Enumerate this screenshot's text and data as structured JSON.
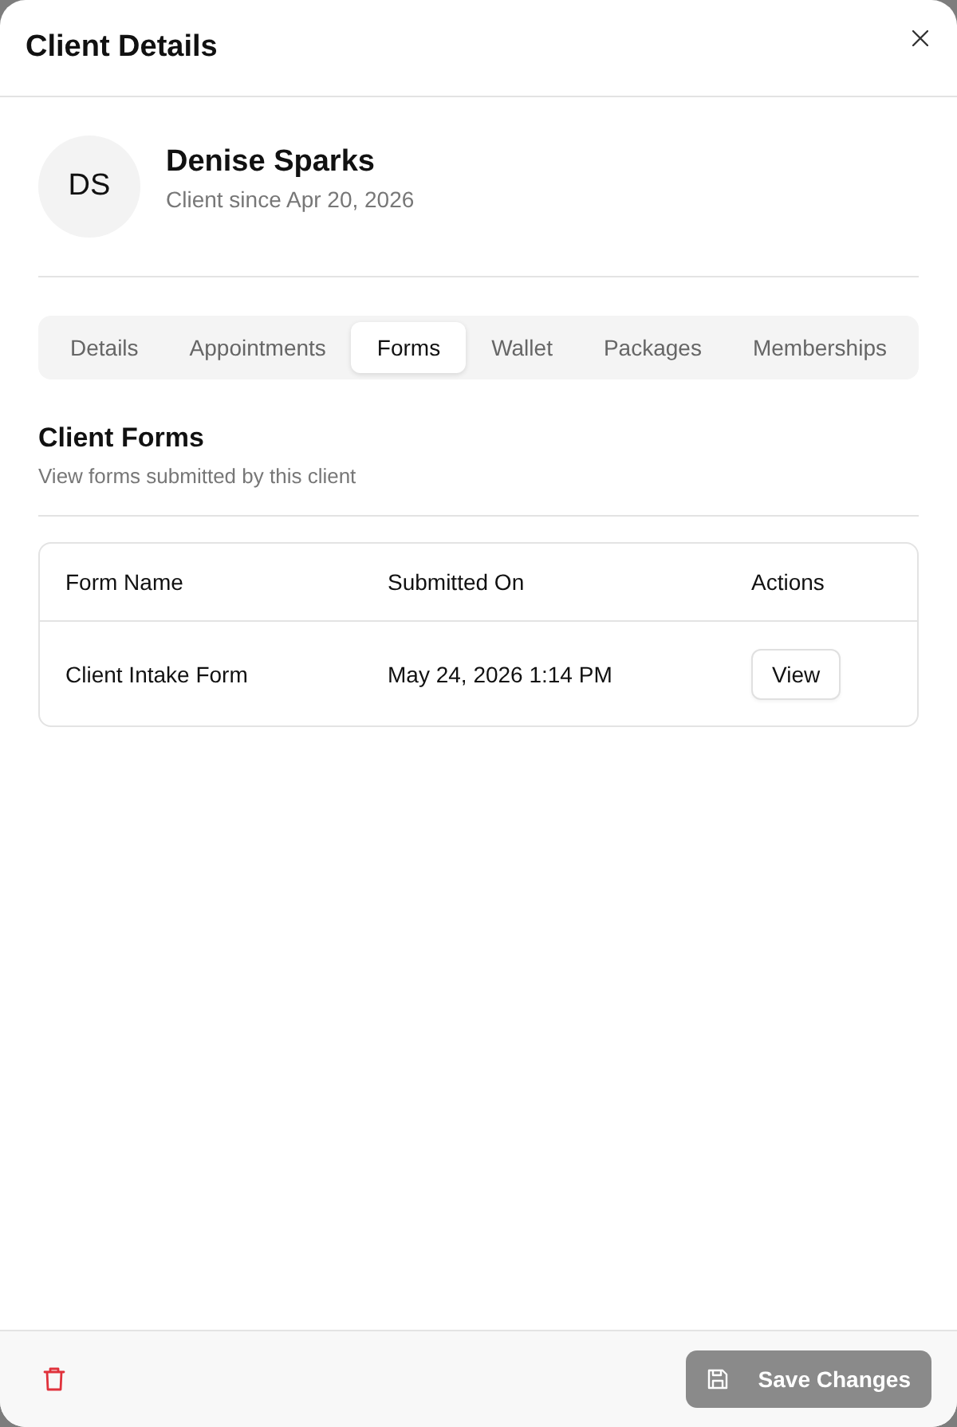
{
  "dialog": {
    "title": "Client Details"
  },
  "client": {
    "initials": "DS",
    "name": "Denise Sparks",
    "since": "Client since Apr 20, 2026"
  },
  "tabs": [
    {
      "label": "Details",
      "selected": false
    },
    {
      "label": "Appointments",
      "selected": false
    },
    {
      "label": "Forms",
      "selected": true
    },
    {
      "label": "Wallet",
      "selected": false
    },
    {
      "label": "Packages",
      "selected": false
    },
    {
      "label": "Memberships",
      "selected": false
    }
  ],
  "section": {
    "title": "Client Forms",
    "subtitle": "View forms submitted by this client"
  },
  "table": {
    "columns": [
      "Form Name",
      "Submitted On",
      "Actions"
    ],
    "rows": [
      {
        "form_name": "Client Intake Form",
        "submitted_on": "May 24, 2026 1:14 PM",
        "action": "View"
      }
    ]
  },
  "footer": {
    "save_button": {
      "label": "Save Changes",
      "disabled": true
    }
  }
}
